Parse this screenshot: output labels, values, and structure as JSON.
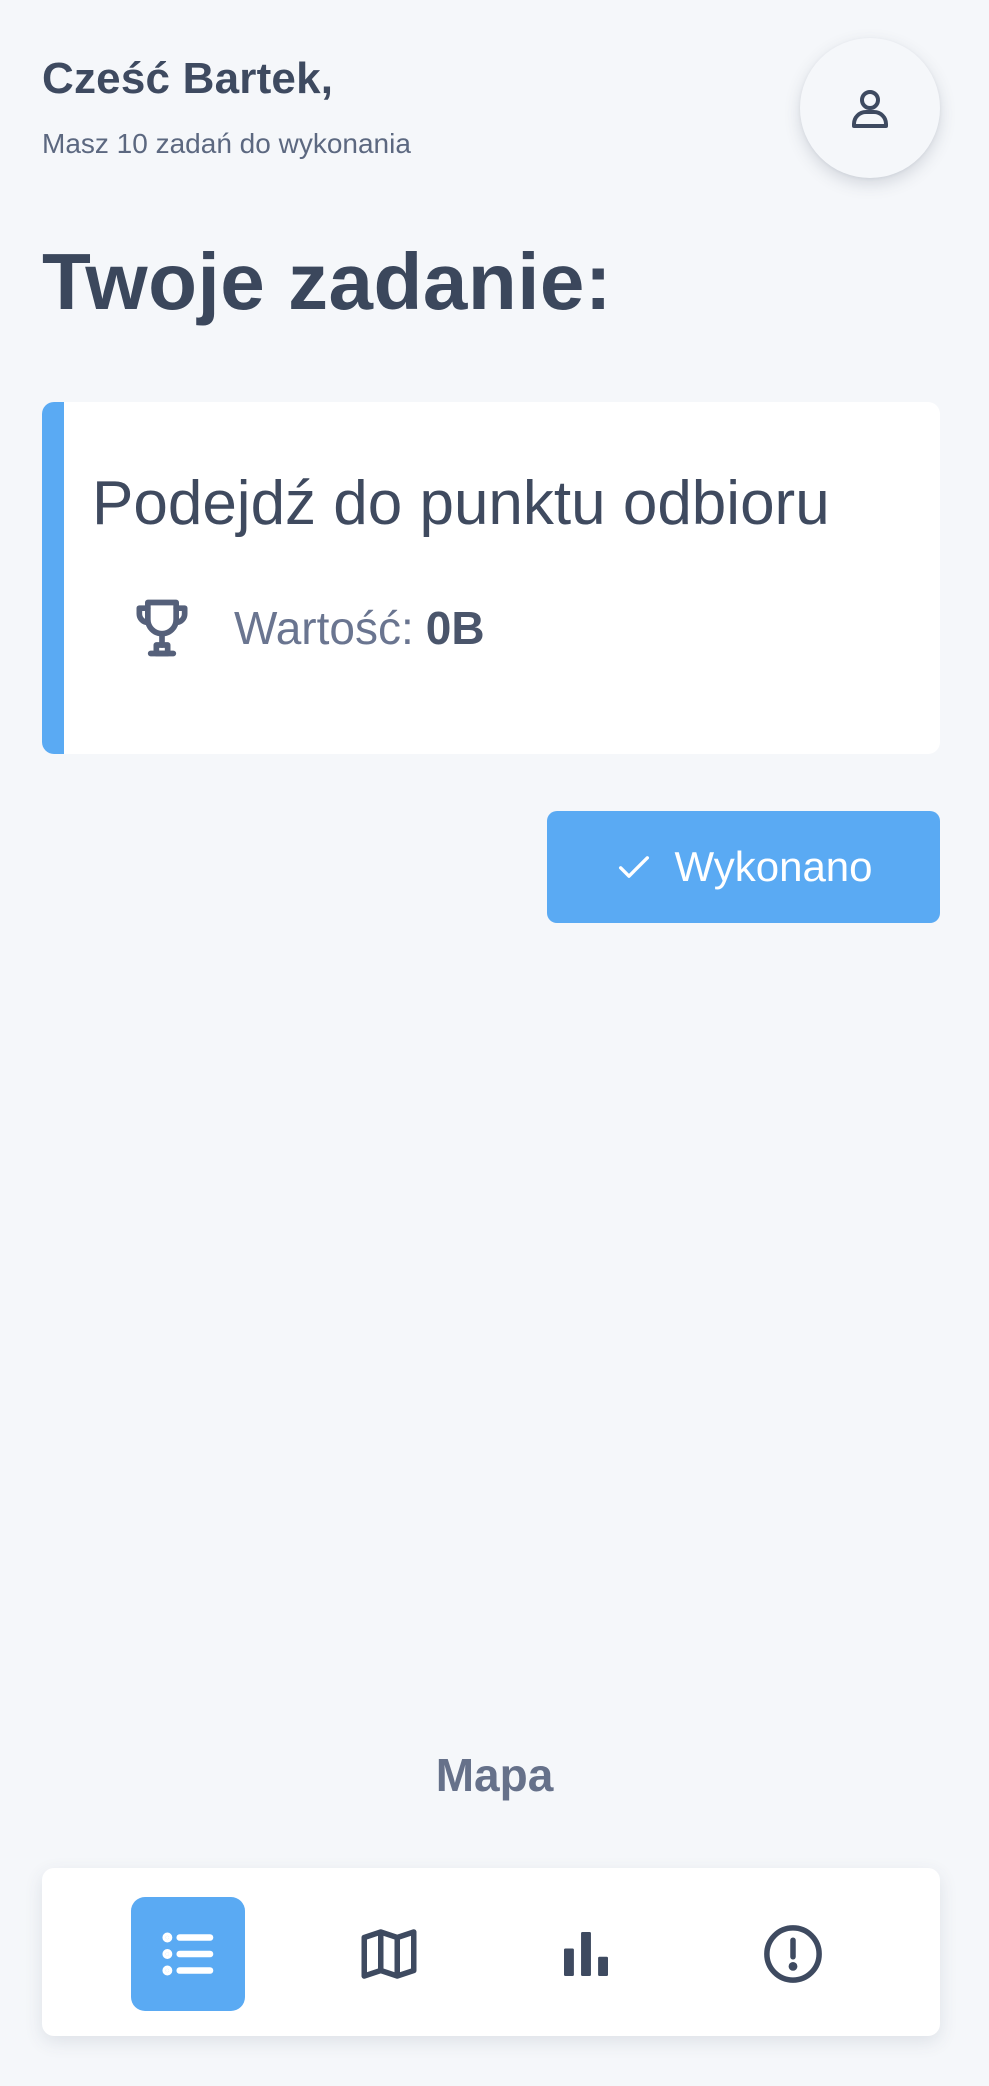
{
  "header": {
    "greeting": "Cześć Bartek,",
    "subtitle": "Masz 10 zadań do wykonania",
    "profile_icon": "user-icon"
  },
  "section": {
    "title": "Twoje zadanie:"
  },
  "task": {
    "title": "Podejdź do punktu odbioru",
    "value_label": "Wartość:",
    "value_amount": "0B",
    "icon": "trophy-icon"
  },
  "actions": {
    "done_label": "Wykonano",
    "done_icon": "check-icon"
  },
  "map_link": {
    "label": "Mapa"
  },
  "bottom_nav": {
    "items": [
      {
        "icon": "list-icon",
        "active": true
      },
      {
        "icon": "map-icon",
        "active": false
      },
      {
        "icon": "bar-chart-icon",
        "active": false
      },
      {
        "icon": "alert-circle-icon",
        "active": false
      }
    ]
  },
  "colors": {
    "accent": "#5aaaf3",
    "background": "#f5f7fa",
    "text_dark": "#3e4a60",
    "text_muted": "#66718a"
  }
}
